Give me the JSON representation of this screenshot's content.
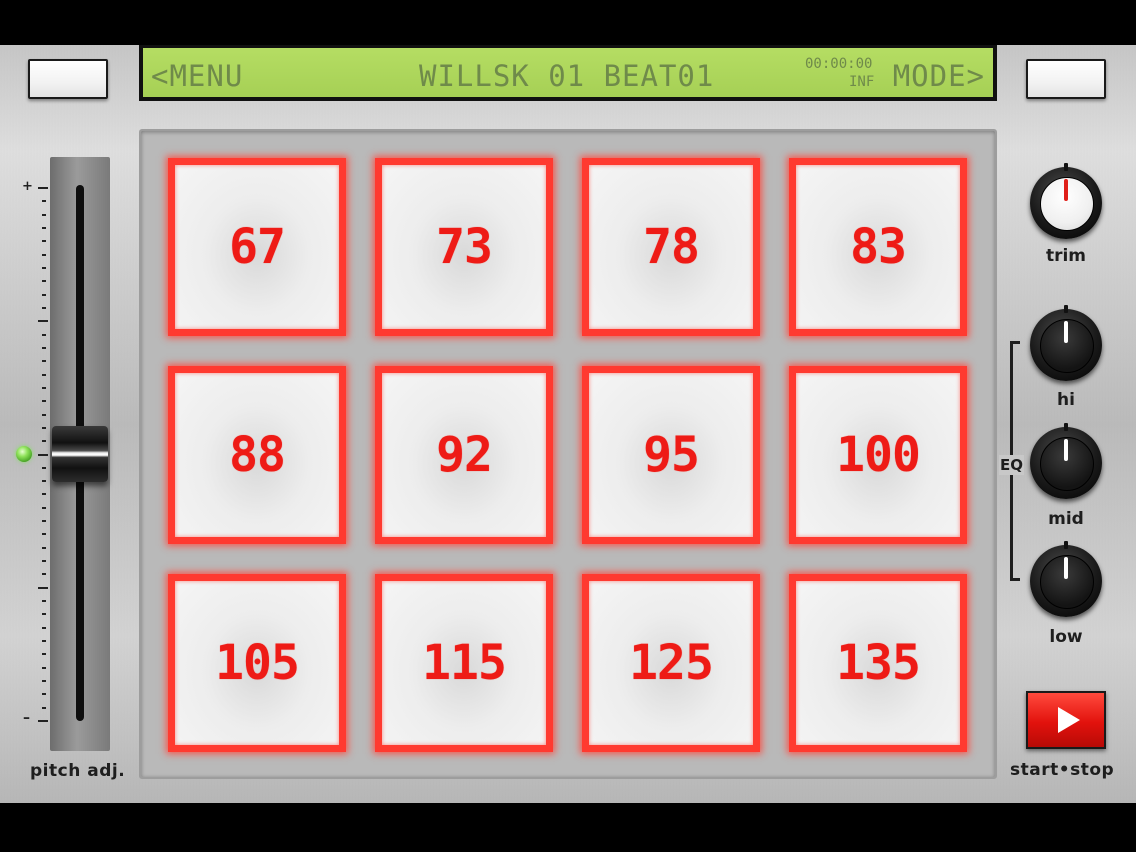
{
  "lcd": {
    "menu": "<MENU",
    "title": "WILLSK 01  BEAT01",
    "time": "00:00:00",
    "inf": "INF",
    "mode": "MODE>"
  },
  "pitch": {
    "label": "pitch adj.",
    "plus": "+",
    "minus": "–",
    "fader_position": 0.5
  },
  "pads": [
    {
      "label": "67"
    },
    {
      "label": "73"
    },
    {
      "label": "78"
    },
    {
      "label": "83"
    },
    {
      "label": "88"
    },
    {
      "label": "92"
    },
    {
      "label": "95"
    },
    {
      "label": "100"
    },
    {
      "label": "105"
    },
    {
      "label": "115"
    },
    {
      "label": "125"
    },
    {
      "label": "135"
    }
  ],
  "knobs": {
    "trim": "trim",
    "hi": "hi",
    "mid": "mid",
    "low": "low",
    "eq": "EQ"
  },
  "transport": {
    "label": "start•stop"
  },
  "colors": {
    "lcd_background": "#b5dd63",
    "pad_glow": "#ff3a30",
    "pad_text": "#ee1b16",
    "play_button": "#e2120d"
  },
  "icons": {
    "play": "play-icon"
  }
}
